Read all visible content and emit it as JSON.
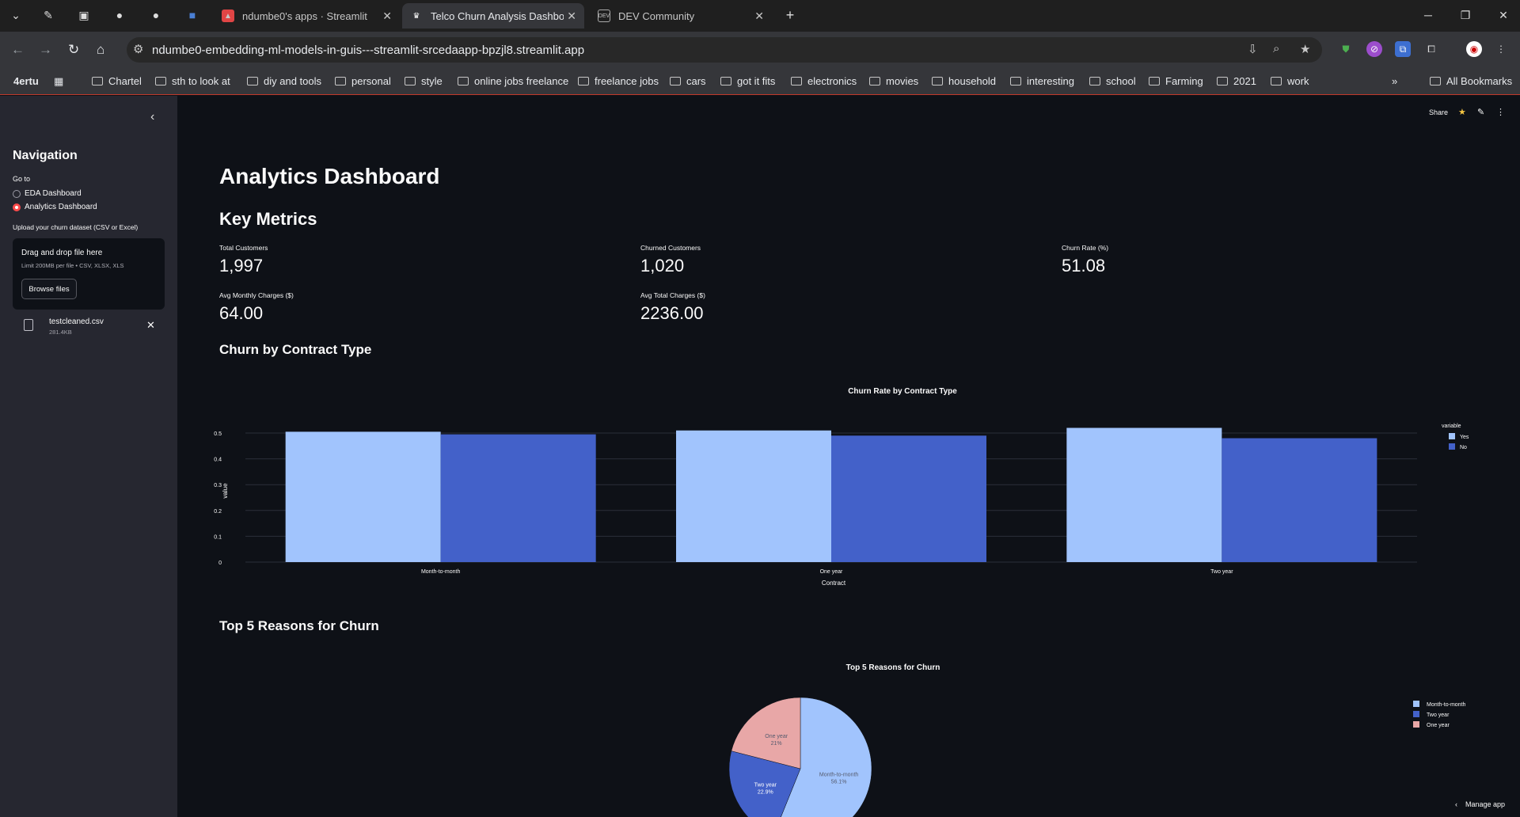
{
  "browser": {
    "tabs": [
      {
        "title": "ndumbe0's apps · Streamlit"
      },
      {
        "title": "Telco Churn Analysis Dashboard"
      },
      {
        "title": "DEV Community"
      }
    ],
    "url": "ndumbe0-embedding-ml-models-in-guis---streamlit-srcedaapp-bpzjl8.streamlit.app",
    "profile_label": "4ertu",
    "bookmarks": [
      "Chartel",
      "sth to look at",
      "diy and tools",
      "personal",
      "style",
      "online jobs freelance",
      "freelance jobs",
      "cars",
      "got it fits",
      "electronics",
      "movies",
      "household",
      "interesting",
      "school",
      "Farming",
      "2021",
      "work"
    ],
    "all_bookmarks": "All Bookmarks"
  },
  "sidebar": {
    "title": "Navigation",
    "goto_label": "Go to",
    "options": [
      "EDA Dashboard",
      "Analytics Dashboard"
    ],
    "selected": "Analytics Dashboard",
    "upload_label": "Upload your churn dataset (CSV or Excel)",
    "dropzone_title": "Drag and drop file here",
    "dropzone_sub": "Limit 200MB per file • CSV, XLSX, XLS",
    "browse_label": "Browse files",
    "file_name": "testcleaned.csv",
    "file_size": "281.4KB"
  },
  "header": {
    "share_label": "Share",
    "manage_label": "Manage app"
  },
  "main": {
    "title": "Analytics Dashboard",
    "metrics_heading": "Key Metrics",
    "metrics": [
      {
        "label": "Total Customers",
        "value": "1,997"
      },
      {
        "label": "Churned Customers",
        "value": "1,020"
      },
      {
        "label": "Churn Rate (%)",
        "value": "51.08"
      },
      {
        "label": "Avg Monthly Charges ($)",
        "value": "64.00"
      },
      {
        "label": "Avg Total Charges ($)",
        "value": "2236.00"
      }
    ],
    "contract_heading": "Churn by Contract Type",
    "reasons_heading": "Top 5 Reasons for Churn"
  },
  "colors": {
    "yes": "#a1c4fd",
    "no": "#4361c9",
    "one_year": "#e8a7a7",
    "accent": "#ff4b4b"
  },
  "chart_data": [
    {
      "type": "bar",
      "title": "Churn Rate by Contract Type",
      "xlabel": "Contract",
      "ylabel": "value",
      "categories": [
        "Month-to-month",
        "One year",
        "Two year"
      ],
      "series": [
        {
          "name": "Yes",
          "values": [
            0.505,
            0.51,
            0.52
          ]
        },
        {
          "name": "No",
          "values": [
            0.495,
            0.49,
            0.48
          ]
        }
      ],
      "ylim": [
        0,
        0.55
      ],
      "yticks": [
        0,
        0.1,
        0.2,
        0.3,
        0.4,
        0.5
      ],
      "legend_title": "variable",
      "legend_position": "top-right"
    },
    {
      "type": "pie",
      "title": "Top 5 Reasons for Churn",
      "labels": [
        "Month-to-month",
        "Two year",
        "One year"
      ],
      "values": [
        56.1,
        22.9,
        21
      ],
      "slice_labels": [
        "Month-to-month\n56.1%",
        "Two year\n22.9%",
        "One year\n21%"
      ],
      "legend_position": "right"
    }
  ]
}
